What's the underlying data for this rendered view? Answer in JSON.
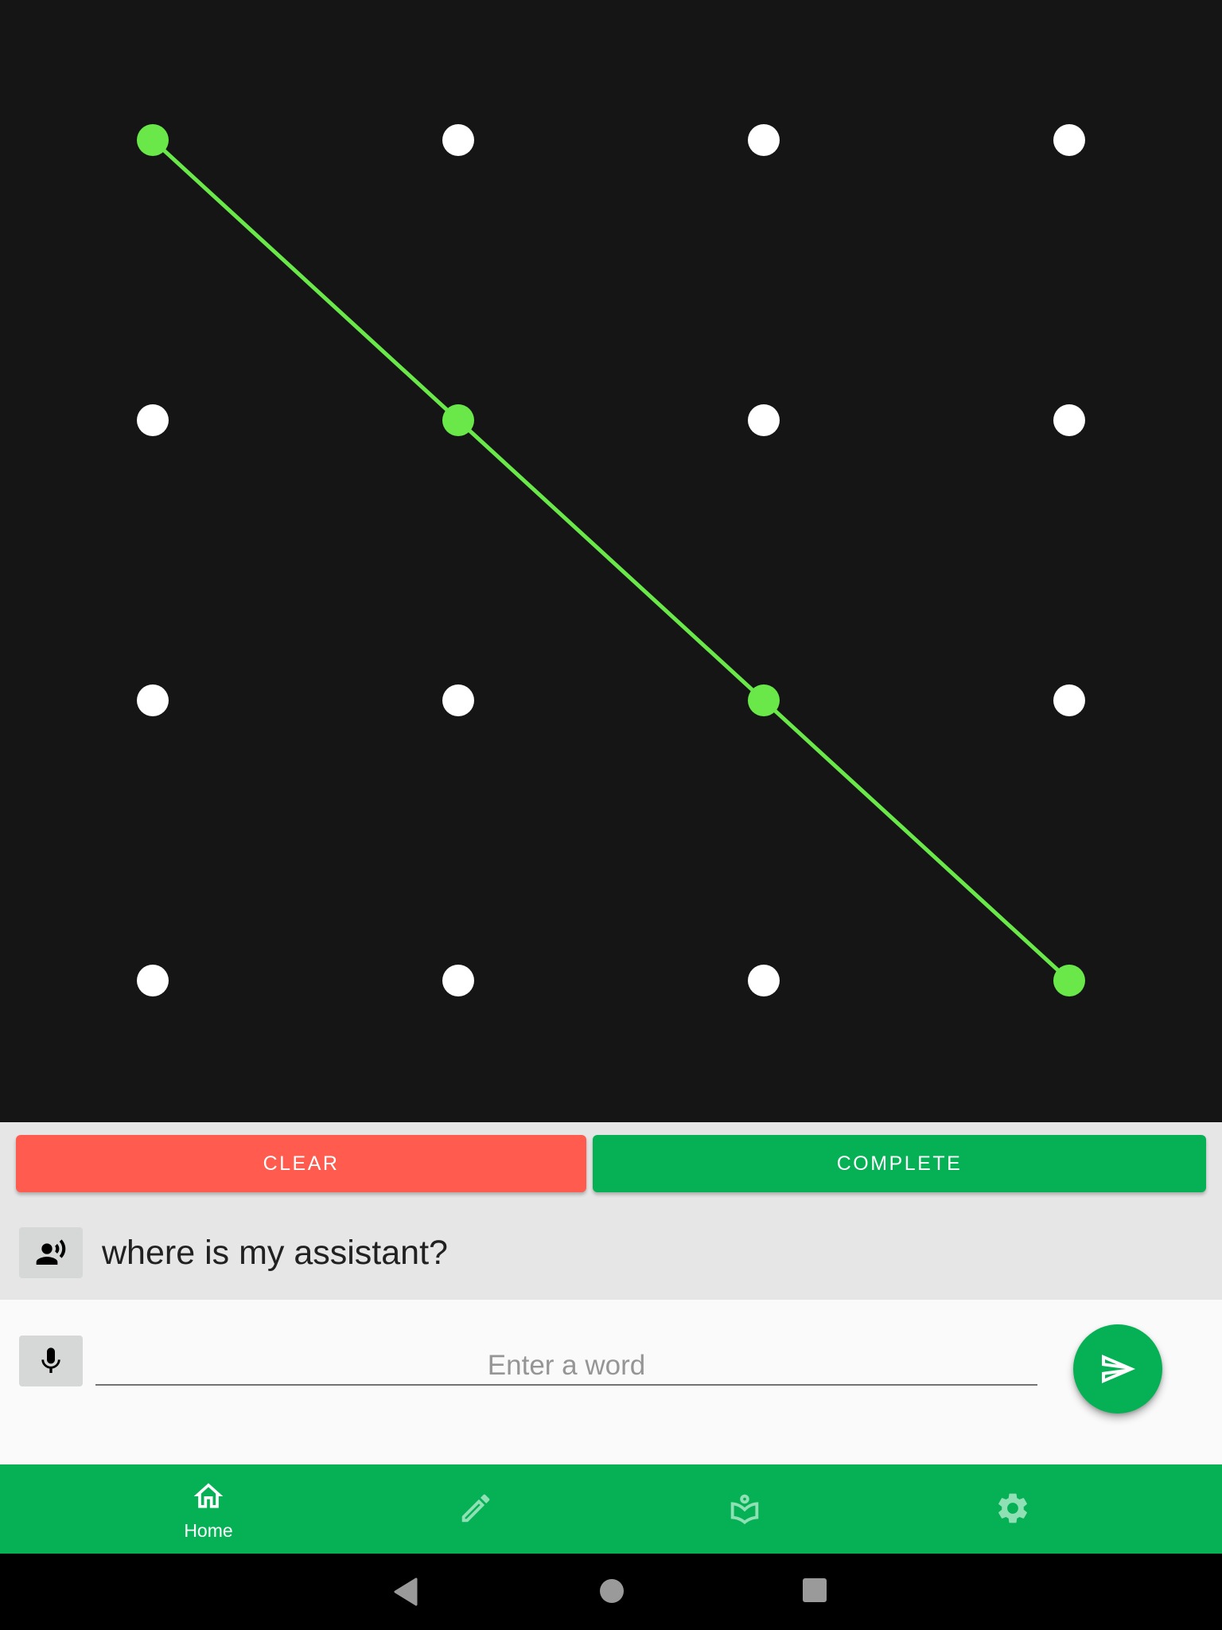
{
  "pattern": {
    "rows": 4,
    "cols": 4,
    "selected_path": [
      [
        0,
        0
      ],
      [
        1,
        1
      ],
      [
        2,
        2
      ],
      [
        3,
        3
      ]
    ],
    "colors": {
      "background": "#151515",
      "dot": "#ffffff",
      "selected_dot": "#6ae84a",
      "line": "#6ae84a"
    }
  },
  "actions": {
    "clear_label": "CLEAR",
    "complete_label": "COMPLETE",
    "clear_color": "#ff5b4f",
    "complete_color": "#05b154"
  },
  "prompt": {
    "icon": "record-voice-icon",
    "text": "where is my assistant?"
  },
  "input": {
    "mic_icon": "mic-icon",
    "value": "",
    "placeholder": "Enter a word",
    "send_icon": "send-icon"
  },
  "bottom_nav": {
    "items": [
      {
        "id": "home",
        "icon": "home-icon",
        "label": "Home",
        "active": true
      },
      {
        "id": "edit",
        "icon": "pencil-icon",
        "label": "",
        "active": false
      },
      {
        "id": "learn",
        "icon": "reader-icon",
        "label": "",
        "active": false
      },
      {
        "id": "settings",
        "icon": "gear-icon",
        "label": "",
        "active": false
      }
    ],
    "color": "#05b154"
  },
  "system_nav": {
    "buttons": [
      "back",
      "home",
      "recents"
    ]
  }
}
